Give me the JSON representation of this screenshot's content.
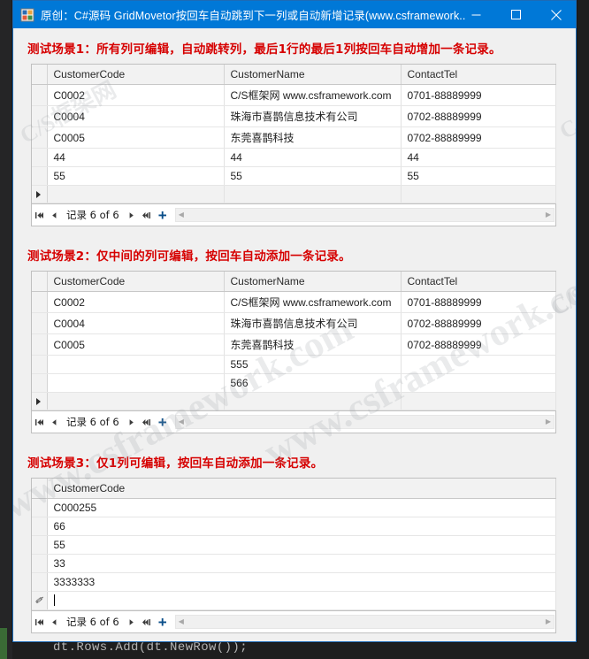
{
  "background": {
    "code_line": "dt.Rows.Add(dt.NewRow());"
  },
  "window": {
    "title": "原创：C#源码 GridMovetor按回车自动跳到下一列或自动新增记录(www.csframework....",
    "icon": "app-icon",
    "accent_color": "#0078d7",
    "buttons": {
      "minimize": "minimize-icon",
      "maximize": "maximize-icon",
      "close": "close-icon"
    }
  },
  "watermark": {
    "line1": "www.csframework.com",
    "line2": "C/S框架网",
    "line3": "www.csframework.com"
  },
  "sections": [
    {
      "title": "测试场景1：所有列可编辑，自动跳转列，最后1行的最后1列按回车自动增加一条记录。",
      "columns": [
        "CustomerCode",
        "CustomerName",
        "ContactTel"
      ],
      "rows": [
        {
          "marker": "",
          "cells": [
            "C0002",
            "C/S框架网 www.csframework.com",
            "0701-88889999"
          ],
          "readonly": [
            false,
            false,
            false
          ]
        },
        {
          "marker": "",
          "cells": [
            "C0004",
            "珠海市喜鹊信息技术有公司",
            "0702-88889999"
          ],
          "readonly": [
            false,
            false,
            false
          ]
        },
        {
          "marker": "",
          "cells": [
            "C0005",
            "东莞喜鹊科技",
            "0702-88889999"
          ],
          "readonly": [
            false,
            false,
            false
          ]
        },
        {
          "marker": "",
          "cells": [
            "44",
            "44",
            "44"
          ],
          "readonly": [
            false,
            false,
            false
          ]
        },
        {
          "marker": "",
          "cells": [
            "55",
            "55",
            "55"
          ],
          "readonly": [
            false,
            false,
            false
          ]
        },
        {
          "marker": "arrow",
          "cells": [
            "",
            "",
            ""
          ],
          "readonly": [
            false,
            false,
            false
          ],
          "new_row": true
        }
      ],
      "navigator": {
        "first": "first-record-icon",
        "prev": "previous-record-icon",
        "label": "记录 6 of 6",
        "next": "next-record-icon",
        "last": "last-record-icon",
        "add": "+"
      }
    },
    {
      "title": "测试场景2：仅中间的列可编辑，按回车自动添加一条记录。",
      "columns": [
        "CustomerCode",
        "CustomerName",
        "ContactTel"
      ],
      "rows": [
        {
          "marker": "",
          "cells": [
            "C0002",
            "C/S框架网 www.csframework.com",
            "0701-88889999"
          ],
          "readonly": [
            true,
            false,
            true
          ]
        },
        {
          "marker": "",
          "cells": [
            "C0004",
            "珠海市喜鹊信息技术有公司",
            "0702-88889999"
          ],
          "readonly": [
            true,
            false,
            true
          ]
        },
        {
          "marker": "",
          "cells": [
            "C0005",
            "东莞喜鹊科技",
            "0702-88889999"
          ],
          "readonly": [
            true,
            false,
            true
          ]
        },
        {
          "marker": "",
          "cells": [
            "",
            "555",
            ""
          ],
          "readonly": [
            true,
            false,
            true
          ]
        },
        {
          "marker": "",
          "cells": [
            "",
            "566",
            ""
          ],
          "readonly": [
            true,
            false,
            true
          ]
        },
        {
          "marker": "arrow",
          "cells": [
            "",
            "",
            ""
          ],
          "readonly": [
            true,
            false,
            true
          ],
          "new_row": true
        }
      ],
      "navigator": {
        "first": "first-record-icon",
        "prev": "previous-record-icon",
        "label": "记录 6 of 6",
        "next": "next-record-icon",
        "last": "last-record-icon",
        "add": "+"
      }
    },
    {
      "title": "测试场景3：仅1列可编辑，按回车自动添加一条记录。",
      "columns": [
        "CustomerCode"
      ],
      "rows": [
        {
          "marker": "",
          "cells": [
            "C000255"
          ],
          "readonly": [
            false
          ]
        },
        {
          "marker": "",
          "cells": [
            "66"
          ],
          "readonly": [
            false
          ]
        },
        {
          "marker": "",
          "cells": [
            "55"
          ],
          "readonly": [
            false
          ]
        },
        {
          "marker": "",
          "cells": [
            "33"
          ],
          "readonly": [
            false
          ]
        },
        {
          "marker": "",
          "cells": [
            "3333333"
          ],
          "readonly": [
            false
          ]
        },
        {
          "marker": "pencil",
          "cells": [
            ""
          ],
          "readonly": [
            false
          ],
          "editing": true
        }
      ],
      "navigator": {
        "first": "first-record-icon",
        "prev": "previous-record-icon",
        "label": "记录 6 of 6",
        "next": "next-record-icon",
        "last": "last-record-icon",
        "add": "+"
      }
    }
  ]
}
